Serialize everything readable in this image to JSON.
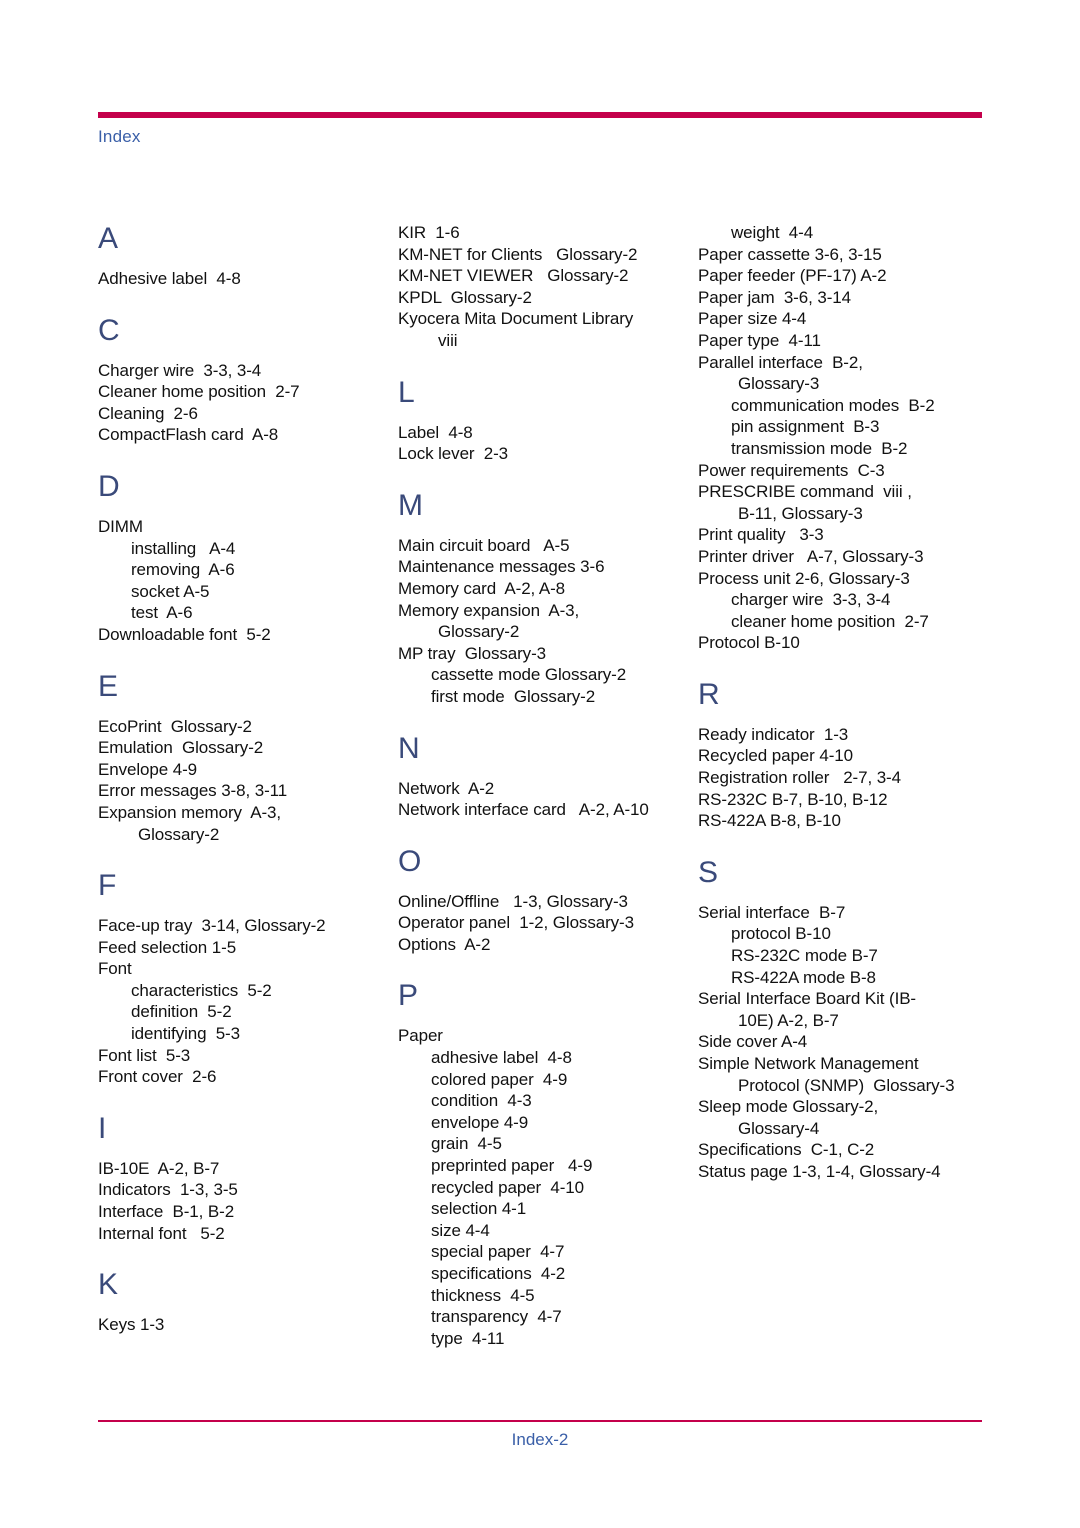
{
  "header": {
    "label": "Index",
    "rule_color": "#C4004B",
    "label_color": "#3A5FA8"
  },
  "footer": {
    "page_label": "Index-2",
    "rule_color": "#C4004B",
    "label_color": "#3A5FA8"
  },
  "letter_color": "#3A4A7A",
  "columns": [
    {
      "name": "column-1",
      "groups": [
        {
          "letter": "A",
          "entries": [
            {
              "text": "Adhesive label  4-8",
              "level": 0
            }
          ]
        },
        {
          "letter": "C",
          "entries": [
            {
              "text": "Charger wire  3-3, 3-4",
              "level": 0
            },
            {
              "text": "Cleaner home position  2-7",
              "level": 0
            },
            {
              "text": "Cleaning  2-6",
              "level": 0
            },
            {
              "text": "CompactFlash card  A-8",
              "level": 0
            }
          ]
        },
        {
          "letter": "D",
          "entries": [
            {
              "text": "DIMM",
              "level": 0
            },
            {
              "text": "installing   A-4",
              "level": 1
            },
            {
              "text": "removing  A-6",
              "level": 1
            },
            {
              "text": "socket A-5",
              "level": 1
            },
            {
              "text": "test  A-6",
              "level": 1
            },
            {
              "text": "Downloadable font  5-2",
              "level": 0
            }
          ]
        },
        {
          "letter": "E",
          "entries": [
            {
              "text": "EcoPrint  Glossary-2",
              "level": 0
            },
            {
              "text": "Emulation  Glossary-2",
              "level": 0
            },
            {
              "text": "Envelope 4-9",
              "level": 0
            },
            {
              "text": "Error messages 3-8, 3-11",
              "level": 0
            },
            {
              "text": "Expansion memory  A-3,",
              "level": 0
            },
            {
              "text": "Glossary-2",
              "level": 2
            }
          ]
        },
        {
          "letter": "F",
          "entries": [
            {
              "text": "Face-up tray  3-14, Glossary-2",
              "level": 0
            },
            {
              "text": "Feed selection 1-5",
              "level": 0
            },
            {
              "text": "Font",
              "level": 0
            },
            {
              "text": "characteristics  5-2",
              "level": 1
            },
            {
              "text": "definition  5-2",
              "level": 1
            },
            {
              "text": "identifying  5-3",
              "level": 1
            },
            {
              "text": "Font list  5-3",
              "level": 0
            },
            {
              "text": "Front cover  2-6",
              "level": 0
            }
          ]
        },
        {
          "letter": "I",
          "entries": [
            {
              "text": "IB-10E  A-2, B-7",
              "level": 0
            },
            {
              "text": "Indicators  1-3, 3-5",
              "level": 0
            },
            {
              "text": "Interface  B-1, B-2",
              "level": 0
            },
            {
              "text": "Internal font   5-2",
              "level": 0
            }
          ]
        },
        {
          "letter": "K",
          "entries": [
            {
              "text": "Keys 1-3",
              "level": 0
            }
          ]
        }
      ]
    },
    {
      "name": "column-2",
      "groups": [
        {
          "letter": "",
          "entries": [
            {
              "text": "KIR  1-6",
              "level": 0
            },
            {
              "text": "KM-NET for Clients   Glossary-2",
              "level": 0
            },
            {
              "text": "KM-NET VIEWER   Glossary-2",
              "level": 0
            },
            {
              "text": "KPDL  Glossary-2",
              "level": 0
            },
            {
              "text": "Kyocera Mita Document Library",
              "level": 0
            },
            {
              "text": "viii",
              "level": 2
            }
          ]
        },
        {
          "letter": "L",
          "entries": [
            {
              "text": "Label  4-8",
              "level": 0
            },
            {
              "text": "Lock lever  2-3",
              "level": 0
            }
          ]
        },
        {
          "letter": "M",
          "entries": [
            {
              "text": "Main circuit board   A-5",
              "level": 0
            },
            {
              "text": "Maintenance messages 3-6",
              "level": 0
            },
            {
              "text": "Memory card  A-2, A-8",
              "level": 0
            },
            {
              "text": "Memory expansion  A-3,",
              "level": 0
            },
            {
              "text": "Glossary-2",
              "level": 2
            },
            {
              "text": "MP tray  Glossary-3",
              "level": 0
            },
            {
              "text": "cassette mode Glossary-2",
              "level": 1
            },
            {
              "text": "first mode  Glossary-2",
              "level": 1
            }
          ]
        },
        {
          "letter": "N",
          "entries": [
            {
              "text": "Network  A-2",
              "level": 0
            },
            {
              "text": "Network interface card   A-2, A-10",
              "level": 0
            }
          ]
        },
        {
          "letter": "O",
          "entries": [
            {
              "text": "Online/Offline   1-3, Glossary-3",
              "level": 0
            },
            {
              "text": "Operator panel  1-2, Glossary-3",
              "level": 0
            },
            {
              "text": "Options  A-2",
              "level": 0
            }
          ]
        },
        {
          "letter": "P",
          "entries": [
            {
              "text": "Paper",
              "level": 0
            },
            {
              "text": "adhesive label  4-8",
              "level": 1
            },
            {
              "text": "colored paper  4-9",
              "level": 1
            },
            {
              "text": "condition  4-3",
              "level": 1
            },
            {
              "text": "envelope 4-9",
              "level": 1
            },
            {
              "text": "grain  4-5",
              "level": 1
            },
            {
              "text": "preprinted paper   4-9",
              "level": 1
            },
            {
              "text": "recycled paper  4-10",
              "level": 1
            },
            {
              "text": "selection 4-1",
              "level": 1
            },
            {
              "text": "size 4-4",
              "level": 1
            },
            {
              "text": "special paper  4-7",
              "level": 1
            },
            {
              "text": "specifications  4-2",
              "level": 1
            },
            {
              "text": "thickness  4-5",
              "level": 1
            },
            {
              "text": "transparency  4-7",
              "level": 1
            },
            {
              "text": "type  4-11",
              "level": 1
            }
          ]
        }
      ]
    },
    {
      "name": "column-3",
      "groups": [
        {
          "letter": "",
          "entries": [
            {
              "text": "weight  4-4",
              "level": 1
            },
            {
              "text": "Paper cassette 3-6, 3-15",
              "level": 0
            },
            {
              "text": "Paper feeder (PF-17) A-2",
              "level": 0
            },
            {
              "text": "Paper jam  3-6, 3-14",
              "level": 0
            },
            {
              "text": "Paper size 4-4",
              "level": 0
            },
            {
              "text": "Paper type  4-11",
              "level": 0
            },
            {
              "text": "Parallel interface  B-2,",
              "level": 0
            },
            {
              "text": "Glossary-3",
              "level": 2
            },
            {
              "text": "communication modes  B-2",
              "level": 1
            },
            {
              "text": "pin assignment  B-3",
              "level": 1
            },
            {
              "text": "transmission mode  B-2",
              "level": 1
            },
            {
              "text": "Power requirements  C-3",
              "level": 0
            },
            {
              "text": "PRESCRIBE command  viii ,",
              "level": 0
            },
            {
              "text": "B-11, Glossary-3",
              "level": 2
            },
            {
              "text": "Print quality   3-3",
              "level": 0
            },
            {
              "text": "Printer driver   A-7, Glossary-3",
              "level": 0
            },
            {
              "text": "Process unit 2-6, Glossary-3",
              "level": 0
            },
            {
              "text": "charger wire  3-3, 3-4",
              "level": 1
            },
            {
              "text": "cleaner home position  2-7",
              "level": 1
            },
            {
              "text": "Protocol B-10",
              "level": 0
            }
          ]
        },
        {
          "letter": "R",
          "entries": [
            {
              "text": "Ready indicator  1-3",
              "level": 0
            },
            {
              "text": "Recycled paper 4-10",
              "level": 0
            },
            {
              "text": "Registration roller   2-7, 3-4",
              "level": 0
            },
            {
              "text": "RS-232C B-7, B-10, B-12",
              "level": 0
            },
            {
              "text": "RS-422A B-8, B-10",
              "level": 0
            }
          ]
        },
        {
          "letter": "S",
          "entries": [
            {
              "text": "Serial interface  B-7",
              "level": 0
            },
            {
              "text": "protocol B-10",
              "level": 1
            },
            {
              "text": "RS-232C mode B-7",
              "level": 1
            },
            {
              "text": "RS-422A mode B-8",
              "level": 1
            },
            {
              "text": "Serial Interface Board Kit (IB-",
              "level": 0
            },
            {
              "text": "10E) A-2, B-7",
              "level": 2
            },
            {
              "text": "Side cover A-4",
              "level": 0
            },
            {
              "text": "Simple Network Management",
              "level": 0
            },
            {
              "text": "Protocol (SNMP)  Glossary-3",
              "level": 2
            },
            {
              "text": "Sleep mode Glossary-2,",
              "level": 0
            },
            {
              "text": "Glossary-4",
              "level": 2
            },
            {
              "text": "Specifications  C-1, C-2",
              "level": 0
            },
            {
              "text": "Status page 1-3, 1-4, Glossary-4",
              "level": 0
            }
          ]
        }
      ]
    }
  ]
}
